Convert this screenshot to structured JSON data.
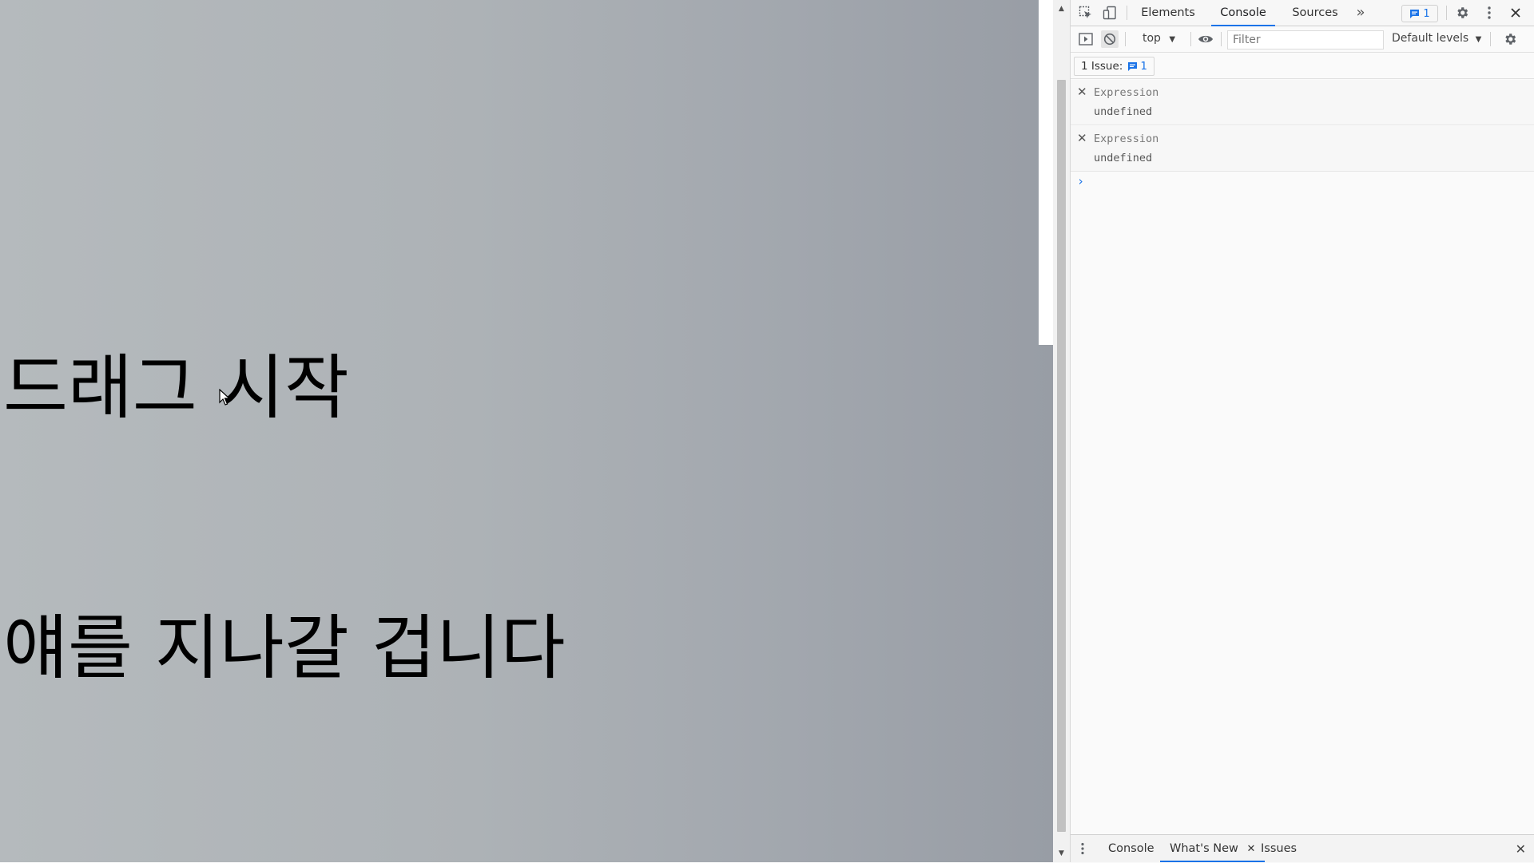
{
  "page": {
    "line1": "드래그 시작",
    "line2": "얘를 지나갈 겁니다"
  },
  "devtools": {
    "tabs": [
      "Elements",
      "Console",
      "Sources"
    ],
    "active_tab": "Console",
    "more_tabs_glyph": "»",
    "issues_badge_count": "1",
    "console_toolbar": {
      "context": "top",
      "filter_placeholder": "Filter",
      "levels": "Default levels"
    },
    "issue_bar": {
      "label": "1 Issue:",
      "count": "1"
    },
    "expressions": [
      {
        "label": "Expression",
        "value": "undefined"
      },
      {
        "label": "Expression",
        "value": "undefined"
      }
    ],
    "prompt_glyph": "›",
    "drawer": {
      "tabs": [
        "Console",
        "What's New",
        "Issues"
      ],
      "active": "What's New"
    }
  },
  "colors": {
    "accent": "#1a73e8",
    "page_gradient_start": "#b5babd",
    "page_gradient_end": "#989da5"
  },
  "icons": [
    "inspect-element-icon",
    "device-toolbar-icon",
    "issues-flag-icon",
    "settings-gear-icon",
    "kebab-menu-icon",
    "close-icon",
    "sidebar-toggle-icon",
    "clear-console-icon",
    "live-expression-eye-icon",
    "console-settings-icon",
    "drawer-menu-icon",
    "mouse-cursor-icon"
  ]
}
